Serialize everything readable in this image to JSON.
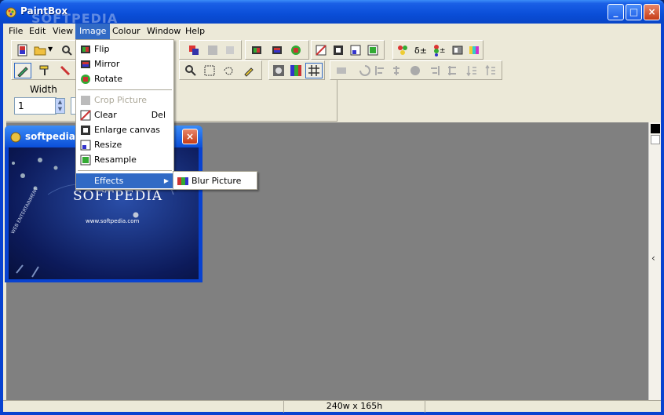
{
  "window": {
    "title": "PaintBox",
    "min": "_",
    "max": "□",
    "close": "×"
  },
  "watermark": "SOFTPEDIA",
  "menubar": [
    "File",
    "Edit",
    "View",
    "Image",
    "Colour",
    "Window",
    "Help"
  ],
  "image_menu": {
    "items": [
      {
        "label": "Flip",
        "shortcut": "",
        "disabled": false
      },
      {
        "label": "Mirror",
        "shortcut": "",
        "disabled": false
      },
      {
        "label": "Rotate",
        "shortcut": "",
        "disabled": false
      },
      {
        "label": "Crop Picture",
        "shortcut": "",
        "disabled": true
      },
      {
        "label": "Clear",
        "shortcut": "Del",
        "disabled": false
      },
      {
        "label": "Enlarge canvas",
        "shortcut": "",
        "disabled": false
      },
      {
        "label": "Resize",
        "shortcut": "",
        "disabled": false
      },
      {
        "label": "Resample",
        "shortcut": "",
        "disabled": false
      },
      {
        "label": "Effects",
        "shortcut": "",
        "disabled": false
      }
    ]
  },
  "effects_submenu": {
    "items": [
      {
        "label": "Blur Picture"
      }
    ]
  },
  "props": {
    "width_label": "Width",
    "width_value": "1"
  },
  "child": {
    "title": "softpedia n",
    "brand": "SOFTPEDIA",
    "url": "www.softpedia.com",
    "curve_text": "WEB ENTERTAINMENT"
  },
  "status": {
    "dimensions": "240w x 165h"
  },
  "colors": {
    "accent": "#316ac5",
    "titlebar": "#0a4ed8",
    "mdi_bg": "#808080"
  }
}
